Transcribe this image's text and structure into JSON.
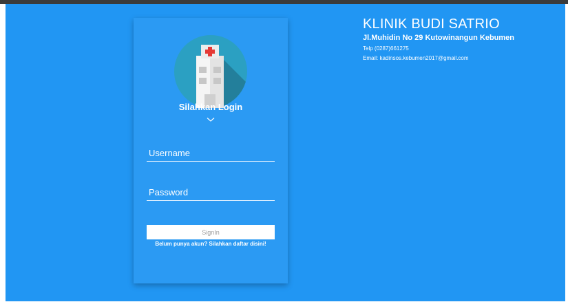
{
  "login": {
    "title": "Silahkan Login",
    "username_placeholder": "Username",
    "password_placeholder": "Password",
    "signin_label": "SignIn",
    "register_text": "Belum punya akun? Silahkan daftar disini!"
  },
  "clinic": {
    "name": "KLINIK BUDI SATRIO",
    "address": "Jl.Muhidin No 29 Kutowinangun Kebumen",
    "phone": "Telp (0287)661275",
    "email": "Email: kadinsos.kebumen2017@gmail.com"
  },
  "icons": {
    "logo": "hospital-building-icon",
    "chevron": "chevron-down-icon"
  },
  "colors": {
    "background": "#2196f3",
    "card": "#2b9af3",
    "logo_circle": "#2ba0c2",
    "cross": "#e53935",
    "text": "#ffffff"
  }
}
